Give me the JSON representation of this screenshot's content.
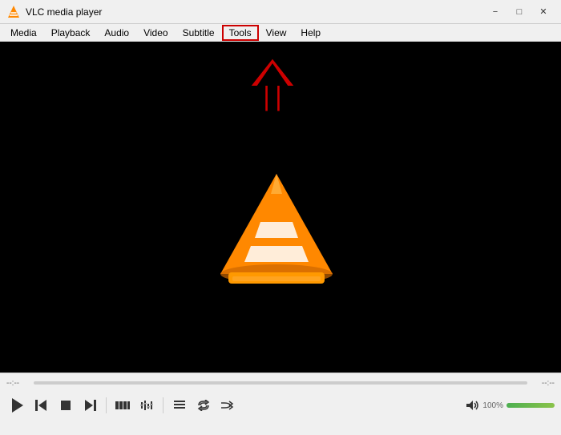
{
  "titlebar": {
    "title": "VLC media player",
    "minimize_label": "−",
    "maximize_label": "□",
    "close_label": "✕"
  },
  "menubar": {
    "items": [
      {
        "id": "media",
        "label": "Media"
      },
      {
        "id": "playback",
        "label": "Playback"
      },
      {
        "id": "audio",
        "label": "Audio"
      },
      {
        "id": "video",
        "label": "Video"
      },
      {
        "id": "subtitle",
        "label": "Subtitle"
      },
      {
        "id": "tools",
        "label": "Tools",
        "highlighted": true
      },
      {
        "id": "view",
        "label": "View"
      },
      {
        "id": "help",
        "label": "Help"
      }
    ]
  },
  "controls": {
    "time_left": "--:--",
    "time_right": "--:--",
    "volume_percent": "100%"
  },
  "buttons": {
    "play": "▶",
    "prev": "⏮",
    "stop": "■",
    "next": "⏭",
    "frame_prev": "◀◀",
    "eq": "⚌",
    "playlist": "☰",
    "loop": "⟳",
    "random": "⇄"
  }
}
